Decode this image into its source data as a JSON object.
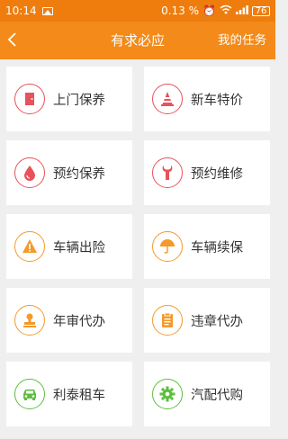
{
  "status_bar": {
    "time": "10:14",
    "signal_pct": "0.13",
    "signal_unit": "%",
    "battery": "76"
  },
  "nav": {
    "title": "有求必应",
    "right_action": "我的任务"
  },
  "services": [
    {
      "label": "上门保养",
      "icon": "door-icon",
      "color": "#e8525b"
    },
    {
      "label": "新车特价",
      "icon": "cone-icon",
      "color": "#e8525b"
    },
    {
      "label": "预约保养",
      "icon": "drop-icon",
      "color": "#e8525b"
    },
    {
      "label": "预约维修",
      "icon": "wrench-icon",
      "color": "#e8525b"
    },
    {
      "label": "车辆出险",
      "icon": "warning-icon",
      "color": "#f39a2a"
    },
    {
      "label": "车辆续保",
      "icon": "umbrella-icon",
      "color": "#f39a2a"
    },
    {
      "label": "年审代办",
      "icon": "stamp-icon",
      "color": "#f39a2a"
    },
    {
      "label": "违章代办",
      "icon": "clipboard-icon",
      "color": "#f39a2a"
    },
    {
      "label": "利泰租车",
      "icon": "car-icon",
      "color": "#5bbf3e"
    },
    {
      "label": "汽配代购",
      "icon": "gear-icon",
      "color": "#5bbf3e"
    }
  ],
  "colors": {
    "status_bar": "#ee7d0e",
    "nav_bar": "#f38a1a",
    "background": "#efefef"
  }
}
